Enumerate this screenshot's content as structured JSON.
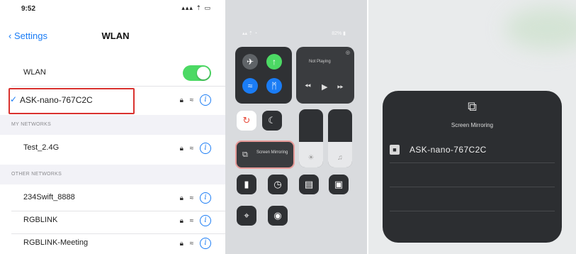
{
  "wlan_settings": {
    "status_time": "9:52",
    "status_icons": "▴▴▴ ⇡ ▭",
    "back_label": "Settings",
    "title": "WLAN",
    "wlan_label": "WLAN",
    "wlan_on": true,
    "connected_network": "ASK-nano-767C2C",
    "my_networks_header": "MY NETWORKS",
    "my_networks": [
      "Test_2.4G"
    ],
    "other_networks_header": "OTHER NETWORKS",
    "other_networks": [
      "234Swift_8888",
      "RGBLINK",
      "RGBLINK-Meeting"
    ],
    "info_glyph": "i",
    "check_glyph": "✓"
  },
  "control_center": {
    "status_left": "▴▴ ⇡ ◔",
    "status_right": "82% ▮",
    "now_playing_label": "Not Playing",
    "screen_mirroring_label": "Screen Mirroring"
  },
  "mirroring_popup": {
    "title": "Screen Mirroring",
    "devices": [
      "ASK-nano-767C2C"
    ]
  },
  "colors": {
    "ios_blue": "#1a7cf5",
    "toggle_green": "#4cd964",
    "highlight_red": "#d9322f",
    "cc_tile": "#2f3134"
  }
}
